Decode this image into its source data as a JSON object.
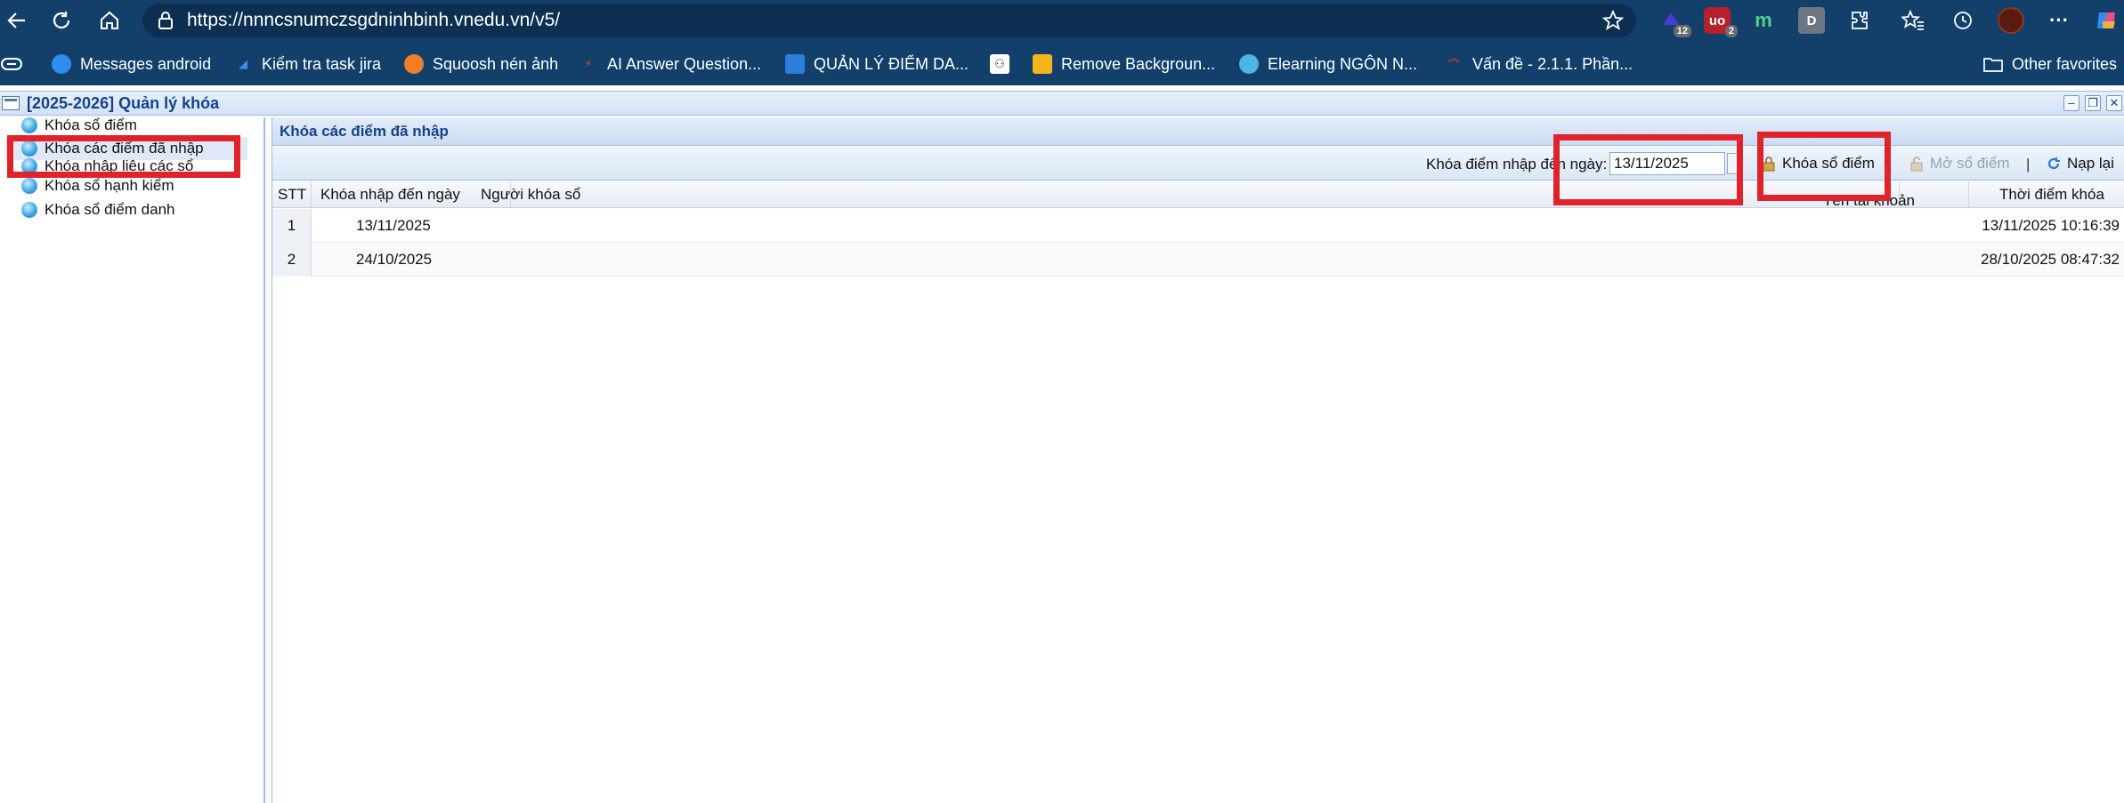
{
  "browser": {
    "url": "https://nnncsnumczsgdninhbinh.vnedu.vn/v5/",
    "extensions": [
      {
        "name": "extension-1",
        "badge": "12"
      },
      {
        "name": "ublock",
        "label": "uo",
        "badge": "2"
      },
      {
        "name": "extension-m",
        "label": "m"
      },
      {
        "name": "extension-d",
        "label": "D"
      }
    ],
    "bookmarks": [
      {
        "label": "Messages android",
        "icon": "messages-icon"
      },
      {
        "label": "Kiểm tra task jira",
        "icon": "jira-icon"
      },
      {
        "label": "Squoosh nén ảnh",
        "icon": "squoosh-icon"
      },
      {
        "label": "AI Answer Question...",
        "icon": "ai-icon"
      },
      {
        "label": "QUẢN LÝ ĐIỂM DA...",
        "icon": "document-icon"
      },
      {
        "label": "",
        "icon": "people-icon"
      },
      {
        "label": "Remove Backgroun...",
        "icon": "remove-bg-icon"
      },
      {
        "label": "Elearning NGÔN N...",
        "icon": "elearning-icon"
      },
      {
        "label": "Vấn đề - 2.1.1. Phần...",
        "icon": "issue-icon"
      }
    ],
    "other_favorites": "Other favorites"
  },
  "app": {
    "title": "[2025-2026] Quản lý khóa",
    "tree": [
      "Khóa sổ điểm",
      "Khóa các điểm đã nhập",
      "Khóa nhập liệu các sổ",
      "Khóa sổ hạnh kiểm",
      "Khóa sổ điểm danh"
    ],
    "panel_title": "Khóa các điểm đã nhập",
    "toolbar": {
      "date_label": "Khóa điểm nhập đến ngày:",
      "date_value": "13/11/2025",
      "lock_button": "Khóa sổ điểm",
      "unlock_button": "Mở sổ điểm",
      "separator": "|",
      "reload_button": "Nạp lại"
    },
    "columns": [
      "STT",
      "Khóa nhập đến ngày",
      "Người khóa sổ",
      "Tên tài khoản",
      "Thời điểm khóa"
    ],
    "rows": [
      {
        "stt": "1",
        "date": "13/11/2025",
        "locker": "",
        "account": "",
        "time": "13/11/2025 10:16:39"
      },
      {
        "stt": "2",
        "date": "24/10/2025",
        "locker": "",
        "account": "",
        "time": "28/10/2025 08:47:32"
      }
    ]
  }
}
